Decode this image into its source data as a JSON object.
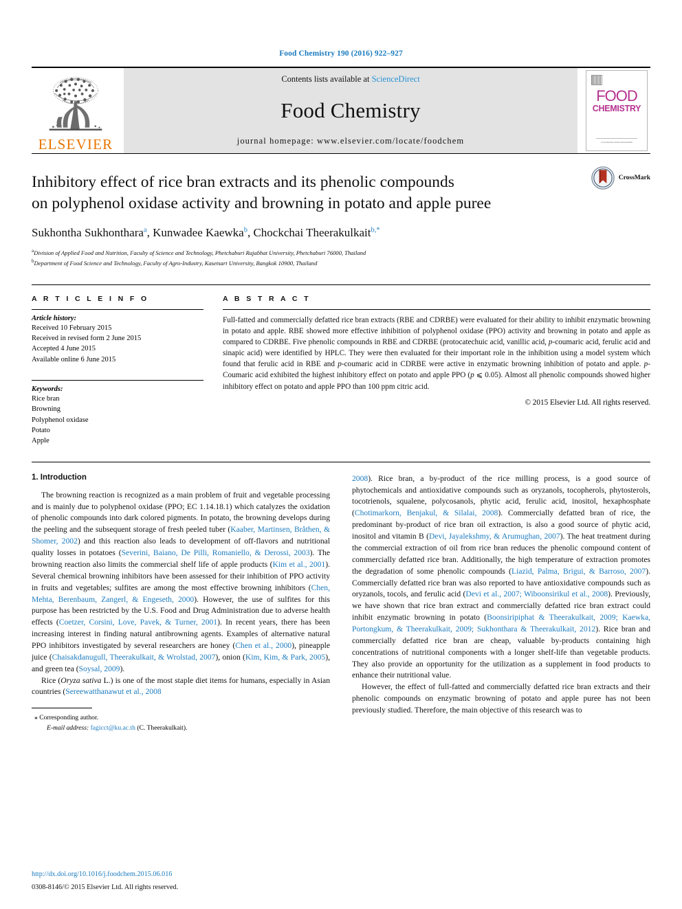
{
  "running_head": "Food Chemistry 190 (2016) 922–927",
  "masthead": {
    "publisher_name": "ELSEVIER",
    "contents_prefix": "Contents lists available at ",
    "contents_link": "ScienceDirect",
    "journal_title": "Food Chemistry",
    "homepage": "journal homepage: www.elsevier.com/locate/foodchem",
    "cover": {
      "word_top": "FOOD",
      "word_bottom": "CHEMISTRY",
      "footer": "www.elsevier.com/locate/foodchem"
    }
  },
  "article": {
    "title_line1": "Inhibitory effect of rice bran extracts and its phenolic compounds",
    "title_line2": "on polyphenol oxidase activity and browning in potato and apple puree",
    "crossmark_label": "CrossMark",
    "authors": [
      {
        "name": "Sukhontha Sukhonthara",
        "sup": "a"
      },
      {
        "name": "Kunwadee Kaewka",
        "sup": "b"
      },
      {
        "name": "Chockchai Theerakulkait",
        "sup": "b,*"
      }
    ],
    "affiliations": [
      {
        "mark": "a",
        "text": "Division of Applied Food and Nutrition, Faculty of Science and Technology, Phetchaburi Rajabhat University, Phetchaburi 76000, Thailand"
      },
      {
        "mark": "b",
        "text": "Department of Food Science and Technology, Faculty of Agro-Industry, Kasetsart University, Bangkok 10900, Thailand"
      }
    ]
  },
  "article_info": {
    "heading": "A R T I C L E   I N F O",
    "history_title": "Article history:",
    "history": [
      "Received 10 February 2015",
      "Received in revised form 2 June 2015",
      "Accepted 4 June 2015",
      "Available online 6 June 2015"
    ],
    "keywords_title": "Keywords:",
    "keywords": [
      "Rice bran",
      "Browning",
      "Polyphenol oxidase",
      "Potato",
      "Apple"
    ]
  },
  "abstract": {
    "heading": "A B S T R A C T",
    "paragraph_a": "Full-fatted and commercially defatted rice bran extracts (RBE and CDRBE) were evaluated for their ability to inhibit enzymatic browning in potato and apple. RBE showed more effective inhibition of polyphenol oxidase (PPO) activity and browning in potato and apple as compared to CDRBE. Five phenolic compounds in RBE and CDRBE (protocatechuic acid, vanillic acid, ",
    "italic_p1": "p",
    "paragraph_b": "-coumaric acid, ferulic acid and sinapic acid) were identified by HPLC. They were then evaluated for their important role in the inhibition using a model system which found that ferulic acid in RBE and ",
    "italic_p2": "p",
    "paragraph_c": "-coumaric acid in CDRBE were active in enzymatic browning inhibition of potato and apple. ",
    "italic_p3": "p",
    "paragraph_d": "-Coumaric acid exhibited the highest inhibitory effect on potato and apple PPO (",
    "italic_p4": "p",
    "paragraph_e": " ⩽ 0.05). Almost all phenolic compounds showed higher inhibitory effect on potato and apple PPO than 100 ppm citric acid.",
    "copyright": "© 2015 Elsevier Ltd. All rights reserved."
  },
  "body": {
    "section_title": "1. Introduction",
    "left_paragraph_1": {
      "t1": "The browning reaction is recognized as a main problem of fruit and vegetable processing and is mainly due to polyphenol oxidase (PPO; EC 1.14.18.1) which catalyzes the oxidation of phenolic compounds into dark colored pigments. In potato, the browning develops during the peeling and the subsequent storage of fresh peeled tuber (",
      "r1": "Kaaber, Martinsen, Bråthen, & Shomer, 2002",
      "t2": ") and this reaction also leads to development of off-flavors and nutritional quality losses in potatoes (",
      "r2": "Severini, Baiano, De Pilli, Romaniello, & Derossi, 2003",
      "t3": "). The browning reaction also limits the commercial shelf life of apple products (",
      "r3": "Kim et al., 2001",
      "t4": "). Several chemical browning inhibitors have been assessed for their inhibition of PPO activity in fruits and vegetables; sulfites are among the most effective browning inhibitors (",
      "r4": "Chen, Mehta, Berenbaum, Zangerl, & Engeseth, 2000",
      "t5": "). However, the use of sulfites for this purpose has been restricted by the U.S. Food and Drug Administration due to adverse health effects (",
      "r5": "Coetzer, Corsini, Love, Pavek, & Turner, 2001",
      "t6": "). In recent years, there has been increasing interest in finding natural antibrowning agents. Examples of alternative natural PPO inhibitors investigated by several researchers are honey (",
      "r6": "Chen et al., 2000",
      "t7": "), pineapple juice (",
      "r7": "Chaisakdanugull, Theerakulkait, & Wrolstad, 2007",
      "t8": "), onion (",
      "r8": "Kim, Kim, & Park, 2005",
      "t9": "), and green tea (",
      "r9": "Soysal, 2009",
      "t10": ")."
    },
    "left_paragraph_2": {
      "t1": "Rice (",
      "i1": "Oryza sativa",
      "t2": " L.) is one of the most staple diet items for humans, especially in Asian countries (",
      "r1": "Sereewatthanawut et al., 2008",
      "t3": ")."
    },
    "right_paragraph_1": {
      "r0": "2008",
      "t1": "). Rice bran, a by-product of the rice milling process, is a good source of phytochemicals and antioxidative compounds such as oryzanols, tocopherols, phytosterols, tocotrienols, squalene, polycosanols, phytic acid, ferulic acid, inositol, hexaphosphate (",
      "r1": "Chotimarkorn, Benjakul, & Silalai, 2008",
      "t2": "). Commercially defatted bran of rice, the predominant by-product of rice bran oil extraction, is also a good source of phytic acid, inositol and vitamin B (",
      "r2": "Devi, Jayalekshmy, & Arumughan, 2007",
      "t3": "). The heat treatment during the commercial extraction of oil from rice bran reduces the phenolic compound content of commercially defatted rice bran. Additionally, the high temperature of extraction promotes the degradation of some phenolic compounds (",
      "r3": "Liazid, Palma, Brigui, & Barroso, 2007",
      "t4": "). Commercially defatted rice bran was also reported to have antioxidative compounds such as oryzanols, tocols, and ferulic acid (",
      "r4": "Devi et al., 2007; Wiboonsirikul et al., 2008",
      "t5": "). Previously, we have shown that rice bran extract and commercially defatted rice bran extract could inhibit enzymatic browning in potato (",
      "r5": "Boonsiripiphat & Theerakulkait, 2009; Kaewka, Portongkum, & Theerakulkait, 2009; Sukhonthara & Theerakulkait, 2012",
      "t6": "). Rice bran and commercially defatted rice bran are cheap, valuable by-products containing high concentrations of nutritional components with a longer shelf-life than vegetable products. They also provide an opportunity for the utilization as a supplement in food products to enhance their nutritional value."
    },
    "right_paragraph_2": {
      "t1": "However, the effect of full-fatted and commercially defatted rice bran extracts and their phenolic compounds on enzymatic browning of potato and apple puree has not been previously studied. Therefore, the main objective of this research was to"
    }
  },
  "footnotes": {
    "corresponding": "Corresponding author.",
    "corresponding_mark": "⁎",
    "email_label": "E-mail address:",
    "email": "fagicct@ku.ac.th",
    "email_owner": "(C. Theerakulkait)."
  },
  "footer": {
    "doi": "http://dx.doi.org/10.1016/j.foodchem.2015.06.016",
    "issn": "0308-8146/© 2015 Elsevier Ltd. All rights reserved."
  },
  "colors": {
    "link_blue": "#1b7bbf",
    "elsevier_orange": "#e87500",
    "cover_magenta": "#b5318f",
    "band_gray": "#e3e3e3"
  }
}
